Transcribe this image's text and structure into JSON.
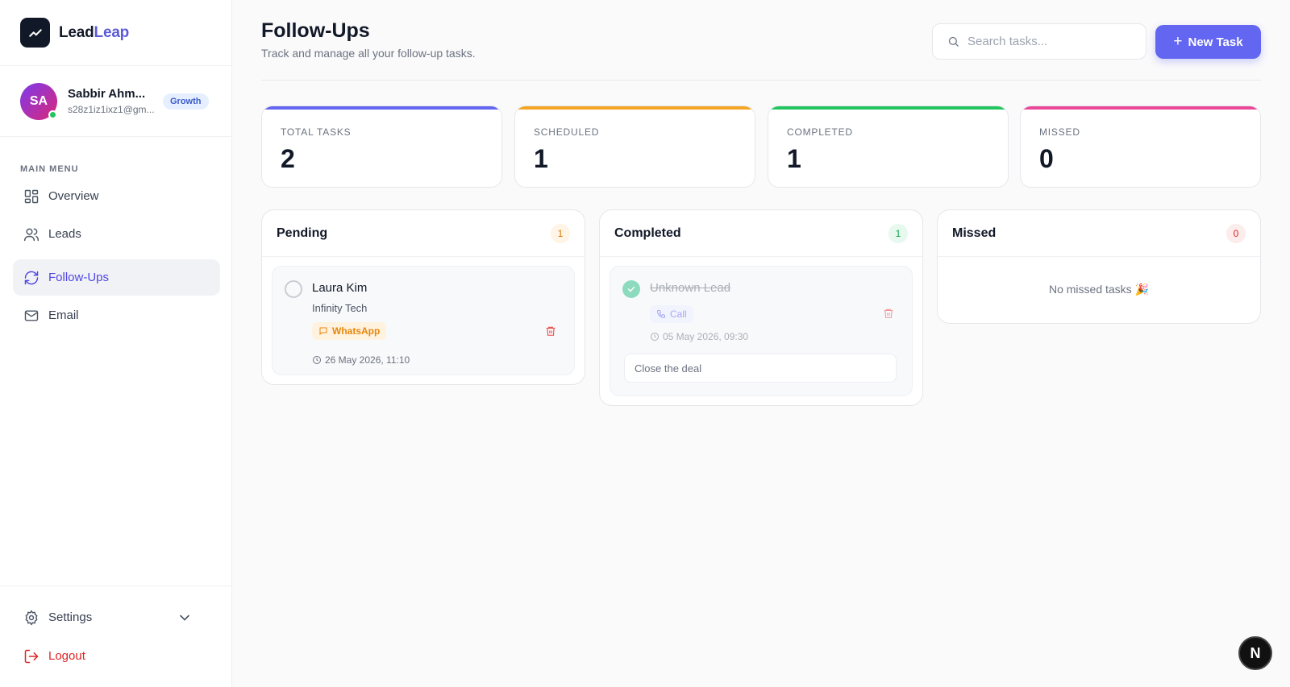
{
  "brand": {
    "name_part1": "Lead",
    "name_part2": "Leap"
  },
  "user": {
    "initials": "SA",
    "name": "Sabbir Ahm...",
    "email": "s28z1iz1ixz1@gm...",
    "plan": "Growth"
  },
  "sidebar": {
    "menu_heading": "MAIN MENU",
    "items": [
      {
        "label": "Overview",
        "icon": "grid-icon"
      },
      {
        "label": "Leads",
        "icon": "users-icon"
      },
      {
        "label": "Follow-Ups",
        "icon": "refresh-icon"
      },
      {
        "label": "Email",
        "icon": "mail-icon"
      }
    ],
    "settings_label": "Settings",
    "logout_label": "Logout"
  },
  "header": {
    "title": "Follow-Ups",
    "subtitle": "Track and manage all your follow-up tasks.",
    "search_placeholder": "Search tasks...",
    "new_task_label": "New Task"
  },
  "stats": [
    {
      "label": "TOTAL TASKS",
      "value": "2",
      "color": "#6366f1"
    },
    {
      "label": "SCHEDULED",
      "value": "1",
      "color": "#f5a524"
    },
    {
      "label": "COMPLETED",
      "value": "1",
      "color": "#22c55e"
    },
    {
      "label": "MISSED",
      "value": "0",
      "color": "#ec4899"
    }
  ],
  "columns": {
    "pending": {
      "title": "Pending",
      "count": "1",
      "tasks": [
        {
          "name": "Laura Kim",
          "company": "Infinity Tech",
          "channel": "WhatsApp",
          "date": "26 May 2026, 11:10"
        }
      ]
    },
    "completed": {
      "title": "Completed",
      "count": "1",
      "tasks": [
        {
          "name": "Unknown Lead",
          "channel": "Call",
          "date": "05 May 2026, 09:30",
          "note": "Close the deal"
        }
      ]
    },
    "missed": {
      "title": "Missed",
      "count": "0",
      "empty_text": "No missed tasks 🎉"
    }
  },
  "corner_badge": "N"
}
